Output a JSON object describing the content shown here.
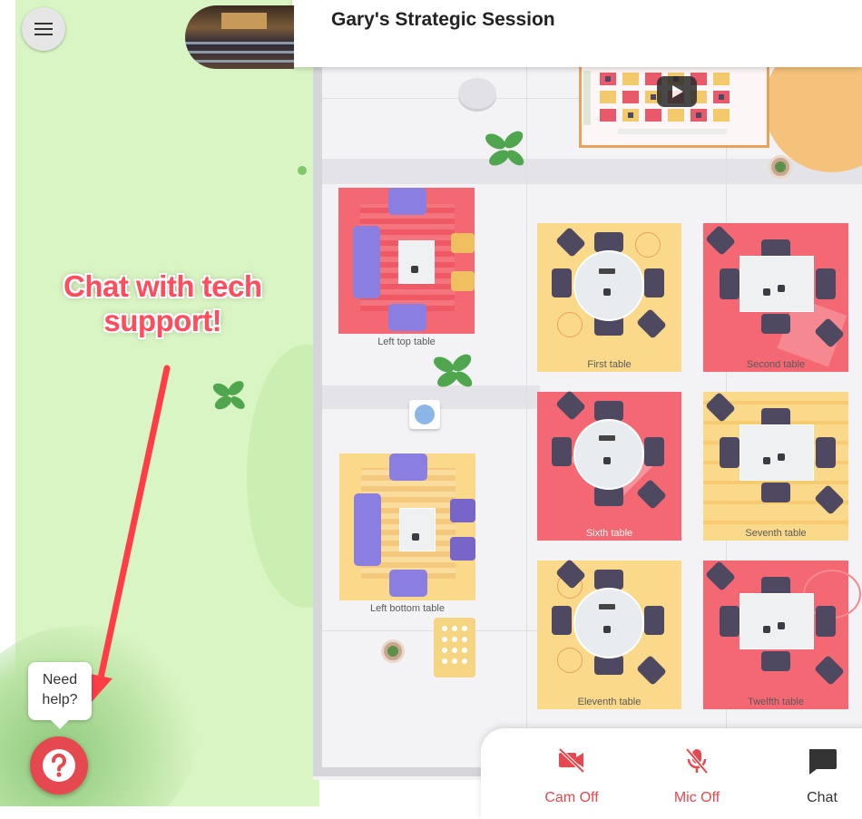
{
  "header": {
    "title": "Gary's Strategic Session"
  },
  "annotation": {
    "line1": "Chat with tech",
    "line2": "support!"
  },
  "rooms": {
    "left_top": "Left top table",
    "left_bottom": "Left bottom table",
    "first": "First table",
    "second": "Second table",
    "sixth": "Sixth table",
    "seventh": "Seventh table",
    "eleventh": "Eleventh table",
    "twelfth": "Twelfth table"
  },
  "help": {
    "line1": "Need",
    "line2": "help?"
  },
  "controls": {
    "cam": "Cam Off",
    "mic": "Mic Off",
    "chat": "Chat"
  },
  "colors": {
    "accent_red": "#e5494f",
    "lawn": "#daf5c4",
    "room_yellow": "#fbd98a",
    "room_pink": "#f46874",
    "chair": "#4e4960",
    "sofa": "#8a7fe0",
    "annotation": "#ff4d5e"
  },
  "icons": {
    "menu": "hamburger-menu-icon",
    "help": "question-mark-icon",
    "cam": "camera-off-icon",
    "mic": "microphone-off-icon",
    "chat": "chat-bubble-icon",
    "play": "play-icon"
  }
}
